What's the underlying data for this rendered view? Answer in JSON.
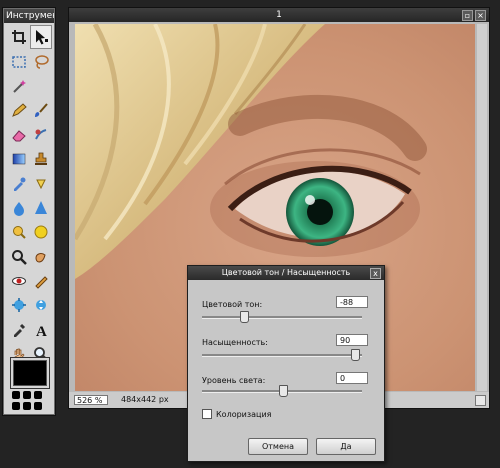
{
  "tools_panel": {
    "title": "Инструмент",
    "tools": [
      {
        "icon": "crop-icon",
        "active": false
      },
      {
        "icon": "move-arrow-icon",
        "active": true
      },
      {
        "icon": "rect-select-icon",
        "active": false
      },
      {
        "icon": "lasso-icon",
        "active": false
      },
      {
        "icon": "magic-wand-icon",
        "active": false
      },
      {
        "icon": "empty",
        "active": false
      },
      {
        "icon": "pencil-icon",
        "active": false
      },
      {
        "icon": "brush-icon",
        "active": false
      },
      {
        "icon": "eraser-icon",
        "active": false
      },
      {
        "icon": "replace-color-icon",
        "active": false
      },
      {
        "icon": "gradient-icon",
        "active": false
      },
      {
        "icon": "stamp-icon",
        "active": false
      },
      {
        "icon": "color-picker-icon",
        "active": false
      },
      {
        "icon": "smudge-icon",
        "active": false
      },
      {
        "icon": "blur-icon",
        "active": false
      },
      {
        "icon": "sharpen-icon",
        "active": false
      },
      {
        "icon": "dodge-icon",
        "active": false
      },
      {
        "icon": "sponge-icon",
        "active": false
      },
      {
        "icon": "zoom-tool-icon",
        "active": false
      },
      {
        "icon": "burn-icon",
        "active": false
      },
      {
        "icon": "red-eye-icon",
        "active": false
      },
      {
        "icon": "spot-heal-icon",
        "active": false
      },
      {
        "icon": "bloat-icon",
        "active": false
      },
      {
        "icon": "pinch-icon",
        "active": false
      },
      {
        "icon": "eyedropper-icon",
        "active": false
      },
      {
        "icon": "text-tool-icon",
        "active": false
      },
      {
        "icon": "hand-icon",
        "active": false
      },
      {
        "icon": "magnifier-icon",
        "active": false
      }
    ],
    "foreground_color": "#000000"
  },
  "image_window": {
    "title": "1",
    "status": {
      "zoom": "526 %",
      "size": "484x442 px"
    }
  },
  "dialog": {
    "title": "Цветовой тон / Насыщенность",
    "close": "x",
    "hue": {
      "label": "Цветовой тон:",
      "value": "-88",
      "min": -180,
      "max": 180
    },
    "saturation": {
      "label": "Насыщенность:",
      "value": "90",
      "min": -100,
      "max": 100
    },
    "lightness": {
      "label": "Уровень света:",
      "value": "0",
      "min": -100,
      "max": 100
    },
    "colorize_label": "Колоризация",
    "cancel_label": "Отмена",
    "ok_label": "Да"
  },
  "colors": {
    "panel_bg": "#d6d6d6",
    "titlebar": "#2e2e2e",
    "skin": "#d39f80",
    "iris": "#2f9b68"
  }
}
